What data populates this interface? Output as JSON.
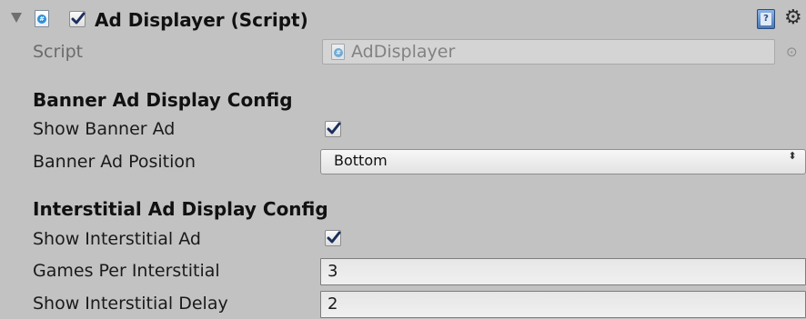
{
  "component": {
    "title": "Ad Displayer (Script)",
    "enabled": true,
    "icons": {
      "foldout": "foldout-expanded-icon",
      "script": "script-icon",
      "help": "help-book-icon",
      "settings": "gear-icon"
    },
    "script_badge": "#"
  },
  "script_field": {
    "label": "Script",
    "value": "AdDisplayer",
    "picker_glyph": "⊙"
  },
  "banner_section": {
    "header": "Banner Ad Display Config",
    "show_banner": {
      "label": "Show Banner Ad",
      "checked": true
    },
    "position": {
      "label": "Banner Ad Position",
      "selected": "Bottom",
      "arrow_glyph": "⬍"
    }
  },
  "interstitial_section": {
    "header": "Interstitial Ad Display Config",
    "show_interstitial": {
      "label": "Show Interstitial Ad",
      "checked": true
    },
    "games_per_interstitial": {
      "label": "Games Per Interstitial",
      "value": "3"
    },
    "show_delay": {
      "label": "Show Interstitial Delay",
      "value": "2"
    }
  },
  "colors": {
    "background": "#c2c2c2",
    "checkmark": "#1b2f5c",
    "script_icon_accent": "#2f8fd6"
  }
}
